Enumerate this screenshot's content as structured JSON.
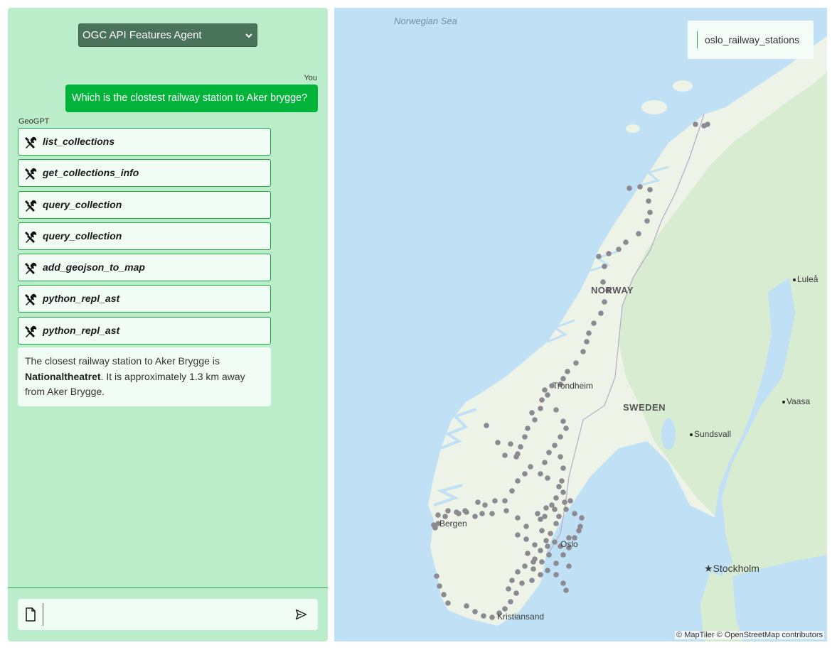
{
  "chat": {
    "agent_select": "OGC API Features Agent",
    "user_label": "You",
    "user_message": "Which is the clostest railway station to Aker brygge?",
    "bot_label": "GeoGPT",
    "tool_calls": [
      {
        "name": "list_collections"
      },
      {
        "name": "get_collections_info"
      },
      {
        "name": "query_collection"
      },
      {
        "name": "query_collection"
      },
      {
        "name": "add_geojson_to_map"
      },
      {
        "name": "python_repl_ast"
      },
      {
        "name": "python_repl_ast"
      }
    ],
    "answer": {
      "pre": "The closest railway station to Aker Brygge is ",
      "bold": "Nationaltheatret",
      "post": ". It is approximately 1.3 km away from Aker Brygge."
    },
    "input_value": "",
    "icons": {
      "tool": "wrench-screwdriver-icon",
      "attach": "file-icon",
      "send": "send-icon",
      "select": "chevron-down-icon"
    }
  },
  "map": {
    "layer_name": "oslo_railway_stations",
    "labels": {
      "sea": "Norwegian Sea",
      "norway": "NORWAY",
      "sweden": "SWEDEN",
      "lulea": "Luleå",
      "vaasa": "Vaasa",
      "sundsvall": "Sundsvall",
      "stockholm": "Stockholm",
      "trondheim": "Trondheim",
      "bergen": "Bergen",
      "oslo": "Oslo",
      "kristiansand": "Kristiansand"
    },
    "attribution": "© MapTiler © OpenStreetMap contributors",
    "colors": {
      "water": "#bfe0f5",
      "land": "#eef3e8",
      "forest": "#d5ebcf",
      "station": "#8c8a90"
    }
  }
}
